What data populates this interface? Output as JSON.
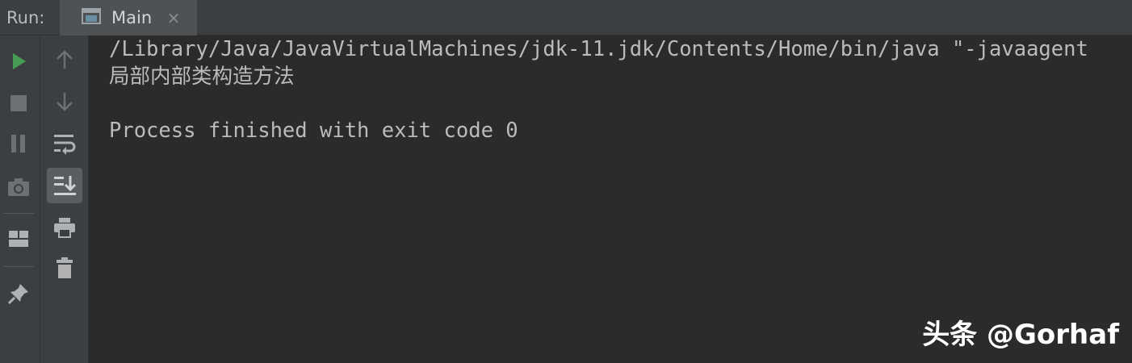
{
  "header": {
    "run_label": "Run:",
    "tab": {
      "label": "Main",
      "close_glyph": "×",
      "icon": "console-window-icon"
    }
  },
  "toolbar_left": {
    "items": [
      {
        "name": "rerun-button",
        "icon": "play-icon",
        "color": "#499c54",
        "enabled": true
      },
      {
        "name": "stop-button",
        "icon": "stop-icon",
        "enabled": false
      },
      {
        "name": "pause-button",
        "icon": "pause-icon",
        "enabled": false
      },
      {
        "name": "thread-dump-button",
        "icon": "camera-icon",
        "enabled": false
      },
      {
        "name": "restore-layout-button",
        "icon": "layout-icon",
        "enabled": true
      },
      {
        "name": "pin-tab-button",
        "icon": "pin-icon",
        "enabled": true
      }
    ]
  },
  "toolbar_right": {
    "items": [
      {
        "name": "up-stack-trace-button",
        "icon": "arrow-up-icon",
        "enabled": false
      },
      {
        "name": "down-stack-trace-button",
        "icon": "arrow-down-icon",
        "enabled": false
      },
      {
        "name": "soft-wrap-button",
        "icon": "soft-wrap-icon",
        "enabled": true
      },
      {
        "name": "scroll-to-end-button",
        "icon": "scroll-to-end-icon",
        "enabled": true,
        "active": true
      },
      {
        "name": "print-button",
        "icon": "printer-icon",
        "enabled": true
      },
      {
        "name": "clear-all-button",
        "icon": "trash-icon",
        "enabled": true
      }
    ]
  },
  "console": {
    "lines": [
      "/Library/Java/JavaVirtualMachines/jdk-11.jdk/Contents/Home/bin/java \"-javaagent",
      "局部内部类构造方法",
      "",
      "Process finished with exit code 0"
    ]
  },
  "watermark": {
    "text": "头条 @Gorhaf"
  },
  "colors": {
    "background": "#2b2b2b",
    "panel": "#3c3f41",
    "active_tab": "#4e5254",
    "text": "#bbbbbb",
    "run_green": "#499c54",
    "disabled_icon": "#6e7173",
    "enabled_icon": "#afb1b3"
  }
}
